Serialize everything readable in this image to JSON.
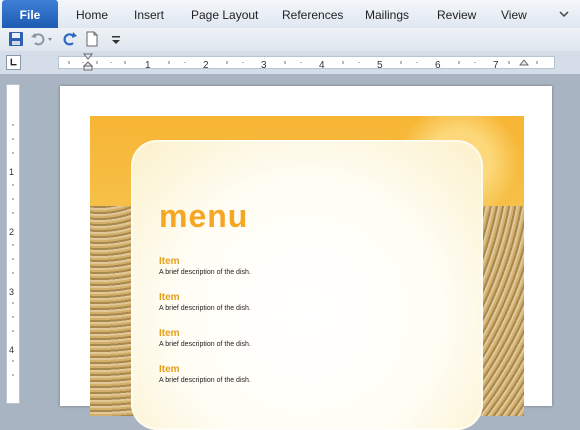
{
  "ribbon": {
    "tabs": [
      {
        "label": "File"
      },
      {
        "label": "Home"
      },
      {
        "label": "Insert"
      },
      {
        "label": "Page Layout"
      },
      {
        "label": "References"
      },
      {
        "label": "Mailings"
      },
      {
        "label": "Review"
      },
      {
        "label": "View"
      }
    ]
  },
  "ruler": {
    "h_numbers": [
      "1",
      "2",
      "3",
      "4",
      "5",
      "6",
      "7"
    ],
    "v_numbers": [
      "1",
      "2",
      "3",
      "4"
    ]
  },
  "document": {
    "title": "menu",
    "items": [
      {
        "name": "Item",
        "desc": "A brief description of the dish."
      },
      {
        "name": "Item",
        "desc": "A brief description of the dish."
      },
      {
        "name": "Item",
        "desc": "A brief description of the dish."
      },
      {
        "name": "Item",
        "desc": "A brief description of the dish."
      }
    ]
  },
  "colors": {
    "file_tab": "#2a6ac4",
    "menu_accent": "#f5a623"
  }
}
